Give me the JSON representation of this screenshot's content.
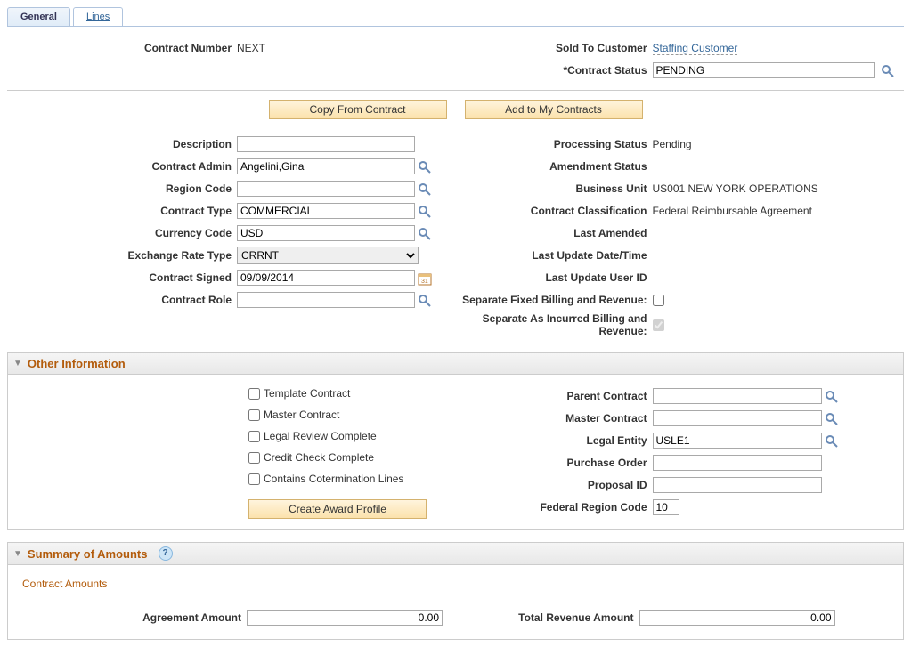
{
  "tabs": {
    "general": "General",
    "lines": "Lines"
  },
  "header": {
    "contract_number_lbl": "Contract Number",
    "contract_number_val": "NEXT",
    "sold_to_lbl": "Sold To Customer",
    "sold_to_link": "Staffing Customer",
    "status_lbl": "*Contract Status",
    "status_val": "PENDING"
  },
  "buttons": {
    "copy": "Copy From Contract",
    "add": "Add to My Contracts",
    "create_award": "Create Award Profile"
  },
  "left": {
    "description_lbl": "Description",
    "description_val": "",
    "admin_lbl": "Contract Admin",
    "admin_val": "Angelini,Gina",
    "region_lbl": "Region Code",
    "region_val": "",
    "type_lbl": "Contract Type",
    "type_val": "COMMERCIAL",
    "currency_lbl": "Currency Code",
    "currency_val": "USD",
    "rate_lbl": "Exchange Rate Type",
    "rate_val": "CRRNT",
    "signed_lbl": "Contract Signed",
    "signed_val": "09/09/2014",
    "role_lbl": "Contract Role",
    "role_val": ""
  },
  "right": {
    "proc_status_lbl": "Processing Status",
    "proc_status_val": "Pending",
    "amend_status_lbl": "Amendment Status",
    "amend_status_val": "",
    "bu_lbl": "Business Unit",
    "bu_val": "US001 NEW YORK OPERATIONS",
    "class_lbl": "Contract Classification",
    "class_val": "Federal Reimbursable Agreement",
    "last_amend_lbl": "Last Amended",
    "last_amend_val": "",
    "last_update_dt_lbl": "Last Update Date/Time",
    "last_update_dt_val": "",
    "last_update_user_lbl": "Last Update User ID",
    "last_update_user_val": "",
    "sep_fixed_lbl": "Separate Fixed Billing and Revenue:",
    "sep_incurred_lbl": "Separate As Incurred Billing and Revenue:"
  },
  "other": {
    "title": "Other Information",
    "template": "Template Contract",
    "master": "Master Contract",
    "legal_review": "Legal Review Complete",
    "credit_check": "Credit Check Complete",
    "coterm": "Contains Cotermination Lines",
    "parent_lbl": "Parent Contract",
    "parent_val": "",
    "master_c_lbl": "Master Contract",
    "master_c_val": "",
    "legal_entity_lbl": "Legal Entity",
    "legal_entity_val": "USLE1",
    "po_lbl": "Purchase Order",
    "po_val": "",
    "proposal_lbl": "Proposal ID",
    "proposal_val": "",
    "fed_region_lbl": "Federal Region Code",
    "fed_region_val": "10"
  },
  "summary": {
    "title": "Summary of Amounts",
    "sub": "Contract Amounts",
    "agreement_lbl": "Agreement Amount",
    "agreement_val": "0.00",
    "revenue_lbl": "Total Revenue Amount",
    "revenue_val": "0.00"
  }
}
